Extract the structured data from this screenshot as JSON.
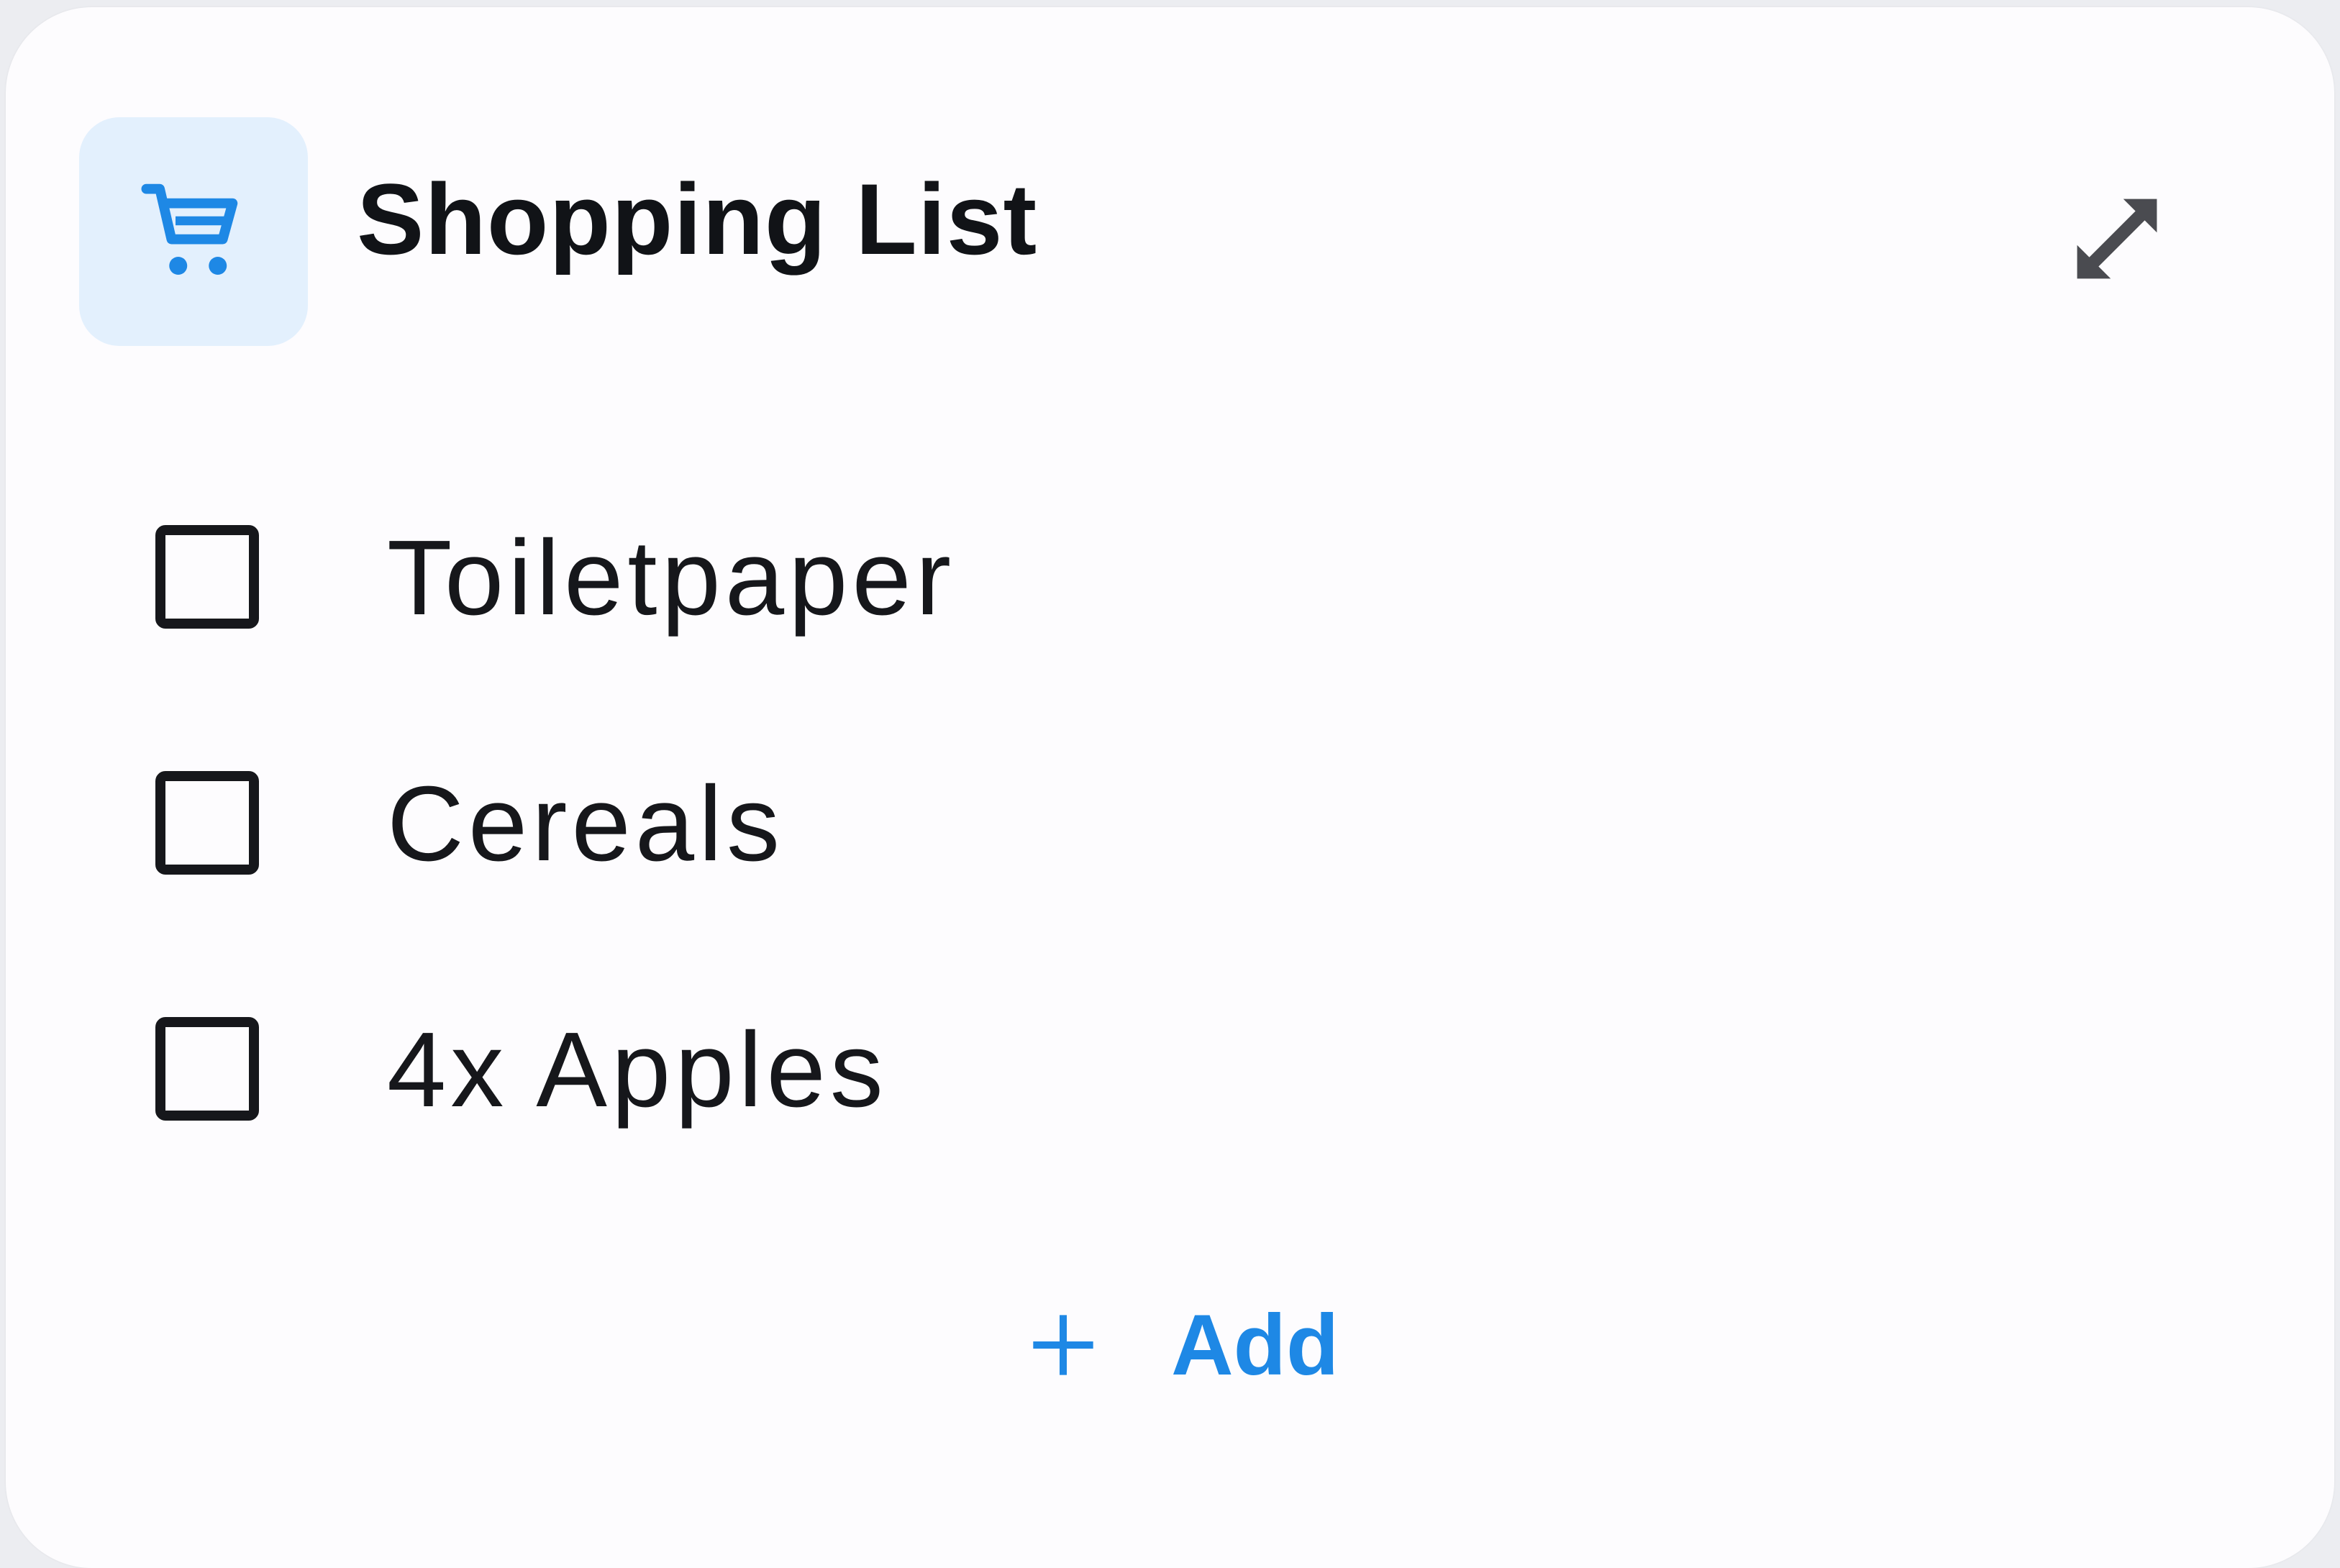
{
  "card": {
    "title": "Shopping List",
    "header_icon": "shopping-cart-icon",
    "expand_icon": "expand-arrows-icon"
  },
  "items": [
    {
      "label": "Toiletpaper",
      "checked": false
    },
    {
      "label": "Cereals",
      "checked": false
    },
    {
      "label": "4x Apples",
      "checked": false
    }
  ],
  "add_button": {
    "label": "Add",
    "icon": "plus-icon"
  },
  "colors": {
    "accent": "#1e88e5",
    "icon_background": "#e3f0fd",
    "text": "#16171b",
    "card_background": "#fdfcfe"
  }
}
